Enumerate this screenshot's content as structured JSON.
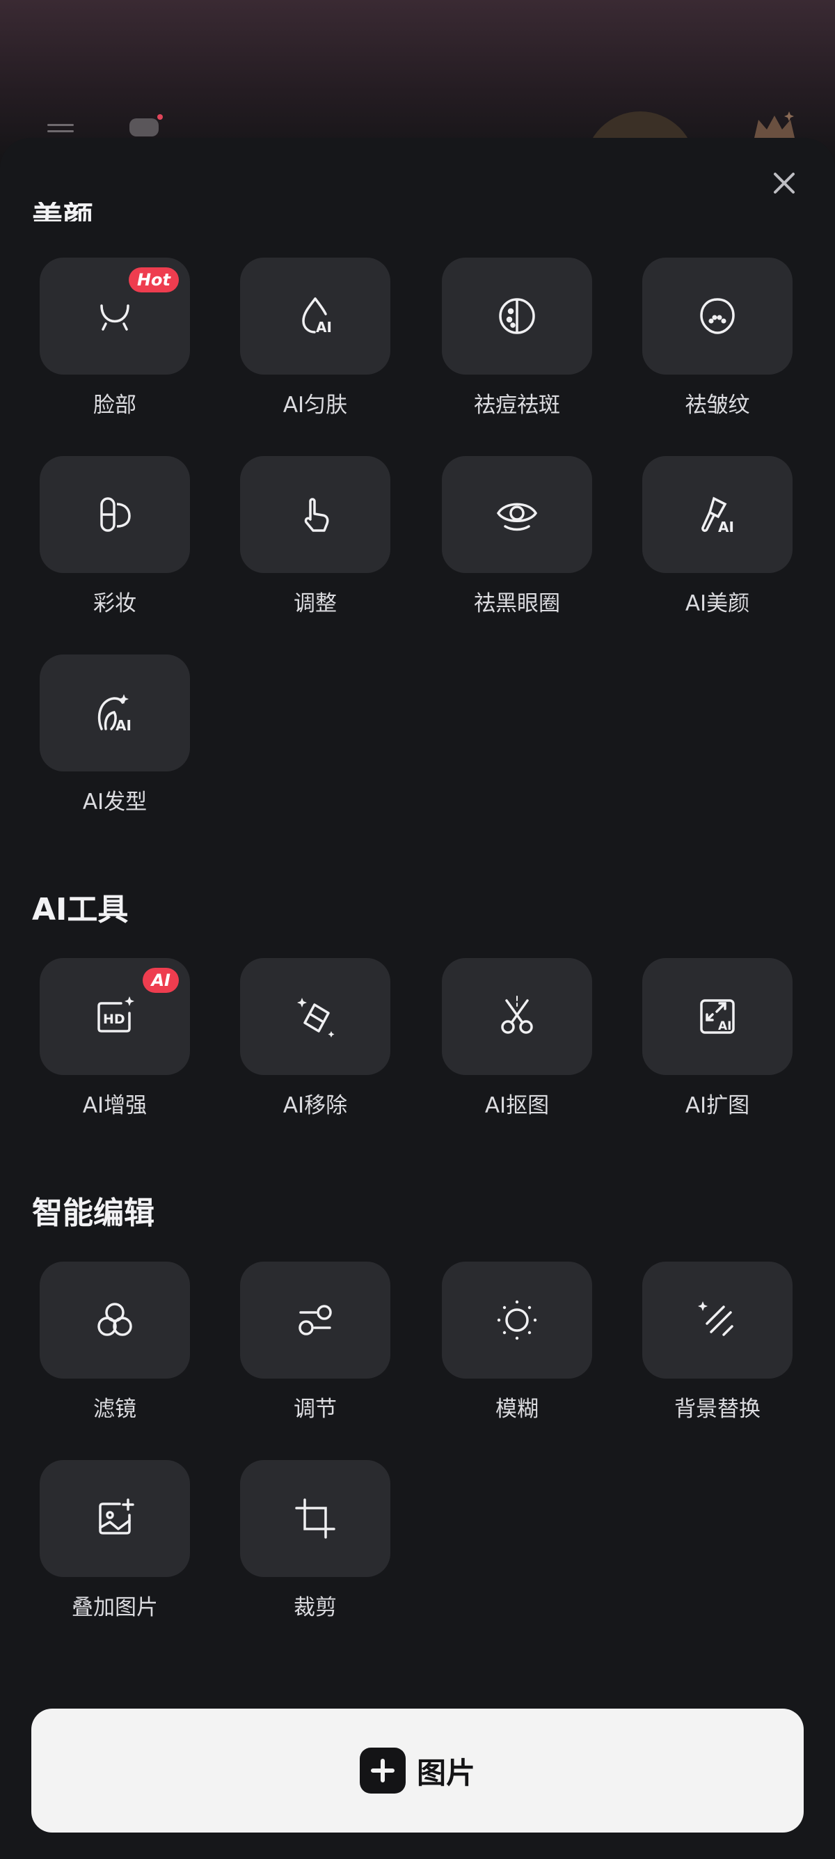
{
  "sections": {
    "beauty": {
      "title": "美颜",
      "items": [
        {
          "label": "脸部",
          "badge": "Hot",
          "icon": "face-contour-icon"
        },
        {
          "label": "AI匀肤",
          "icon": "droplet-ai-icon"
        },
        {
          "label": "祛痘祛斑",
          "icon": "acne-spot-icon"
        },
        {
          "label": "祛皱纹",
          "icon": "wrinkle-face-icon"
        },
        {
          "label": "彩妆",
          "icon": "makeup-icon"
        },
        {
          "label": "调整",
          "icon": "hand-adjust-icon"
        },
        {
          "label": "祛黑眼圈",
          "icon": "eye-icon"
        },
        {
          "label": "AI美颜",
          "icon": "brush-ai-icon"
        },
        {
          "label": "AI发型",
          "icon": "hair-ai-icon"
        }
      ]
    },
    "ai_tools": {
      "title": "AI工具",
      "items": [
        {
          "label": "AI增强",
          "badge": "AI",
          "icon": "hd-enhance-icon"
        },
        {
          "label": "AI移除",
          "icon": "eraser-icon"
        },
        {
          "label": "AI抠图",
          "icon": "scissors-icon"
        },
        {
          "label": "AI扩图",
          "icon": "expand-ai-icon"
        }
      ]
    },
    "smart_edit": {
      "title": "智能编辑",
      "items": [
        {
          "label": "滤镜",
          "icon": "filter-circles-icon"
        },
        {
          "label": "调节",
          "icon": "sliders-icon"
        },
        {
          "label": "模糊",
          "icon": "blur-icon"
        },
        {
          "label": "背景替换",
          "icon": "magic-wand-icon"
        },
        {
          "label": "叠加图片",
          "icon": "add-image-icon"
        },
        {
          "label": "裁剪",
          "icon": "crop-icon"
        }
      ]
    }
  },
  "add_button": {
    "label": "图片",
    "icon": "plus-icon"
  },
  "close_icon": "close-icon",
  "colors": {
    "badge": "#ee3d4f",
    "tile": "#2a2b2f",
    "background": "#16171a"
  }
}
